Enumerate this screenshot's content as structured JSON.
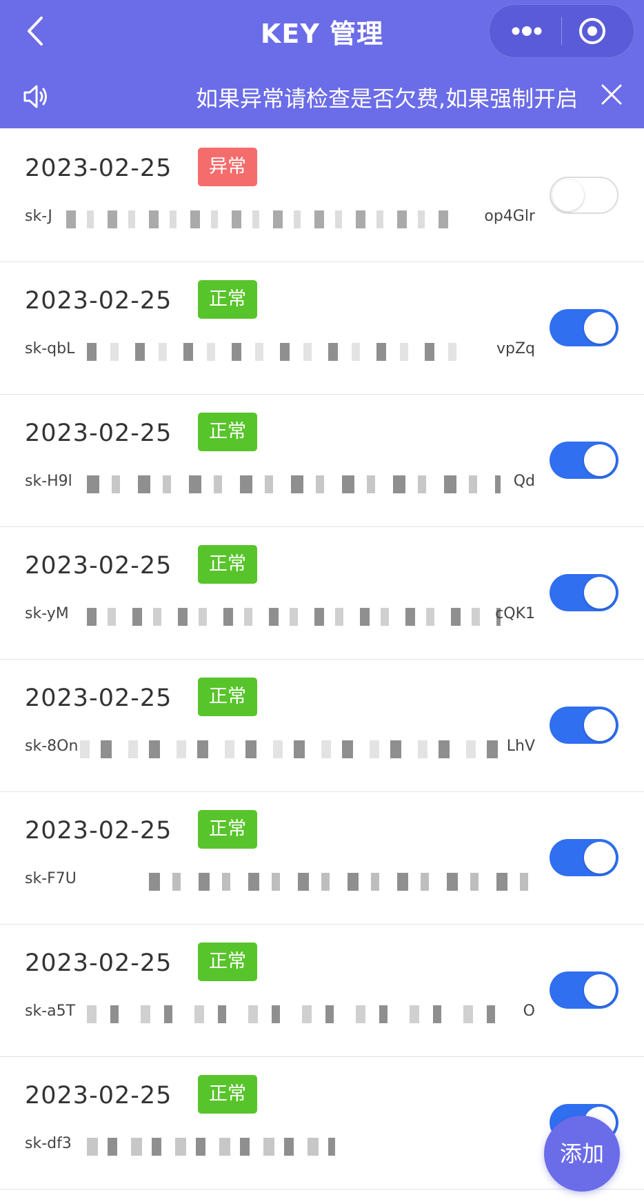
{
  "navbar": {
    "title": "KEY 管理",
    "back_icon": "chevron-left-icon",
    "more_icon": "more-dots-icon",
    "target_icon": "target-circle-icon"
  },
  "notice": {
    "text": "如果异常请检查是否欠费,如果强制开启",
    "speaker_icon": "speaker-icon",
    "close_icon": "close-icon"
  },
  "keys": [
    {
      "date": "2023-02-25",
      "status": "异常",
      "key_start": "sk-J",
      "key_end": "op4Glr",
      "enabled": false
    },
    {
      "date": "2023-02-25",
      "status": "正常",
      "key_start": "sk-qbL",
      "key_end": "vpZq",
      "enabled": true
    },
    {
      "date": "2023-02-25",
      "status": "正常",
      "key_start": "sk-H9l",
      "key_end": "Qd",
      "enabled": true
    },
    {
      "date": "2023-02-25",
      "status": "正常",
      "key_start": "sk-yM",
      "key_end": "cQK1",
      "enabled": true
    },
    {
      "date": "2023-02-25",
      "status": "正常",
      "key_start": "sk-8On",
      "key_end": "LhV",
      "enabled": true
    },
    {
      "date": "2023-02-25",
      "status": "正常",
      "key_start": "sk-F7U",
      "key_end": "",
      "enabled": true
    },
    {
      "date": "2023-02-25",
      "status": "正常",
      "key_start": "sk-a5T",
      "key_end": "O",
      "enabled": true
    },
    {
      "date": "2023-02-25",
      "status": "正常",
      "key_start": "sk-df3",
      "key_end": "",
      "enabled": true
    }
  ],
  "fab": {
    "label": "添加"
  },
  "colors": {
    "primary": "#6b6ce8",
    "switch_on": "#2f6ff0",
    "abnormal": "#f56c6c",
    "normal": "#58c42b"
  }
}
